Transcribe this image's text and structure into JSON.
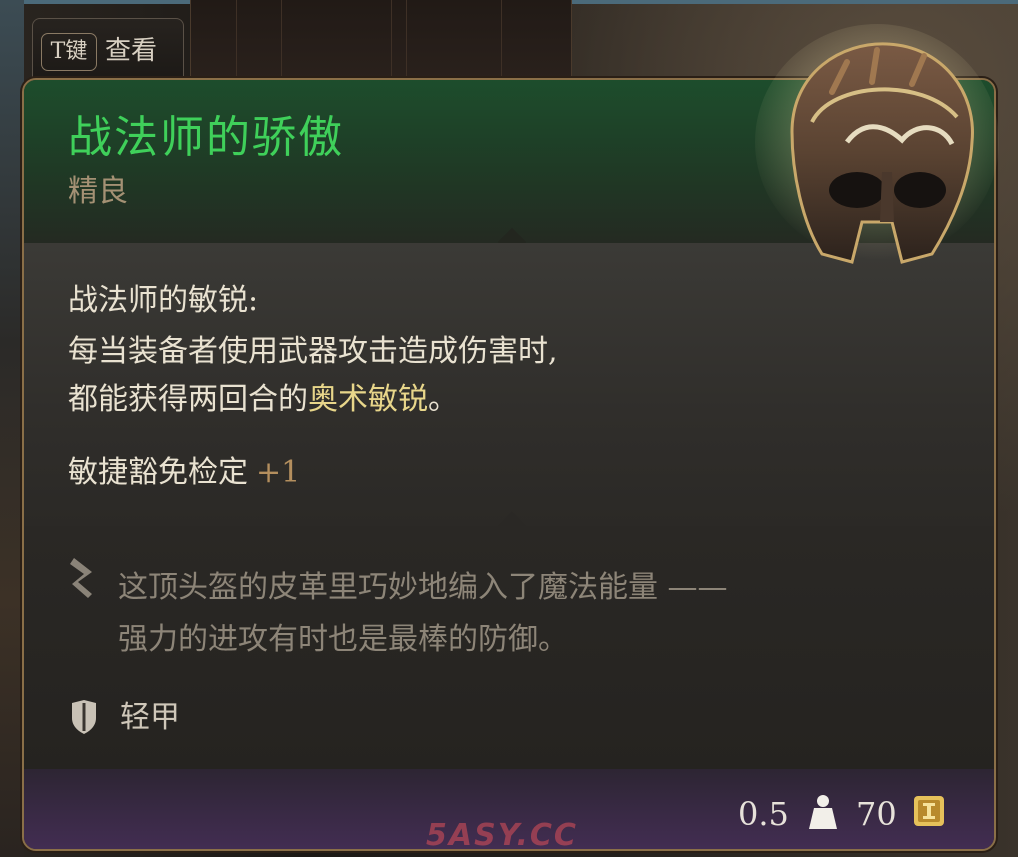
{
  "hint": {
    "key": "T键",
    "label": "查看"
  },
  "item": {
    "name": "战法师的骄傲",
    "rarity": "精良",
    "passive_name": "战法师的敏锐:",
    "passive_desc_plain": "每当装备者使用武器攻击造成伤害时,",
    "passive_desc_line2": "都能获得两回合的",
    "passive_desc_highlight": "奥术敏锐",
    "passive_desc_end": "。",
    "save_bonus_label": "敏捷豁免检定",
    "save_bonus_value": "+1",
    "lore_line1": "这顶头盔的皮革里巧妙地编入了魔法能量 ——",
    "lore_line2": "强力的进攻有时也是最棒的防御。",
    "armor_type": "轻甲",
    "weight": "0.5",
    "price": "70"
  },
  "icons": {
    "quote": "quote-icon",
    "armor": "shield-icon",
    "weight": "weight-icon",
    "gold": "gold-coin-icon",
    "item": "helmet-icon"
  },
  "colors": {
    "title": "#3fd05a",
    "rarity": "#a49174",
    "highlight": "#e8d68a",
    "bonus": "#b48f5e",
    "frame": "#8a6f48",
    "footer": "#3a2a46"
  },
  "watermark": "5ASY.CC"
}
